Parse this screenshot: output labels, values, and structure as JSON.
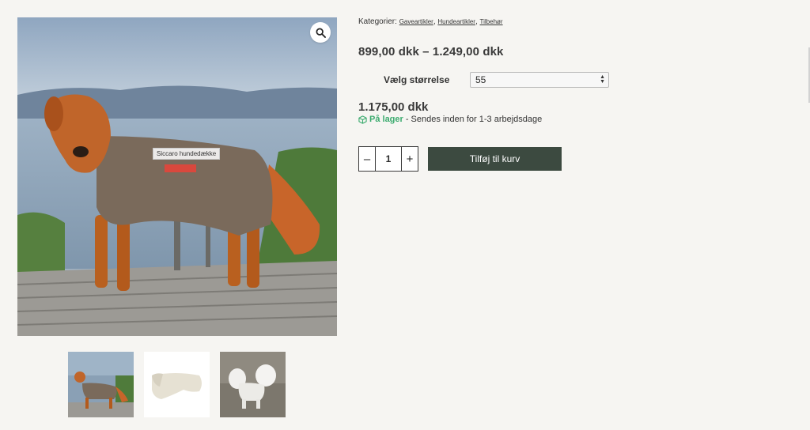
{
  "gallery": {
    "zoom_icon": "magnifier-icon",
    "tooltip": "Siccaro hundedække",
    "thumbnails": [
      {
        "name": "thumbnail-dog-coat-lake"
      },
      {
        "name": "thumbnail-coat-product"
      },
      {
        "name": "thumbnail-white-dogs"
      }
    ]
  },
  "product": {
    "categories_label": "Kategorier:",
    "categories": [
      "Gaveartikler",
      "Hundeartikler",
      "Tilbehør"
    ],
    "category_separator": ",",
    "price_range": "899,00 dkk – 1.249,00 dkk",
    "variation_label": "Vælg størrelse",
    "selected_size": "55",
    "variant_price": "1.175,00 dkk",
    "stock_icon": "box-icon",
    "stock_status": "På lager",
    "stock_note": "- Sendes inden for 1-3 arbejdsdage",
    "quantity": "1",
    "minus_label": "–",
    "plus_label": "+",
    "add_to_cart": "Tilføj til kurv"
  },
  "colors": {
    "background": "#f6f5f2",
    "cart_button": "#3c4a40",
    "in_stock": "#3cab6f"
  }
}
